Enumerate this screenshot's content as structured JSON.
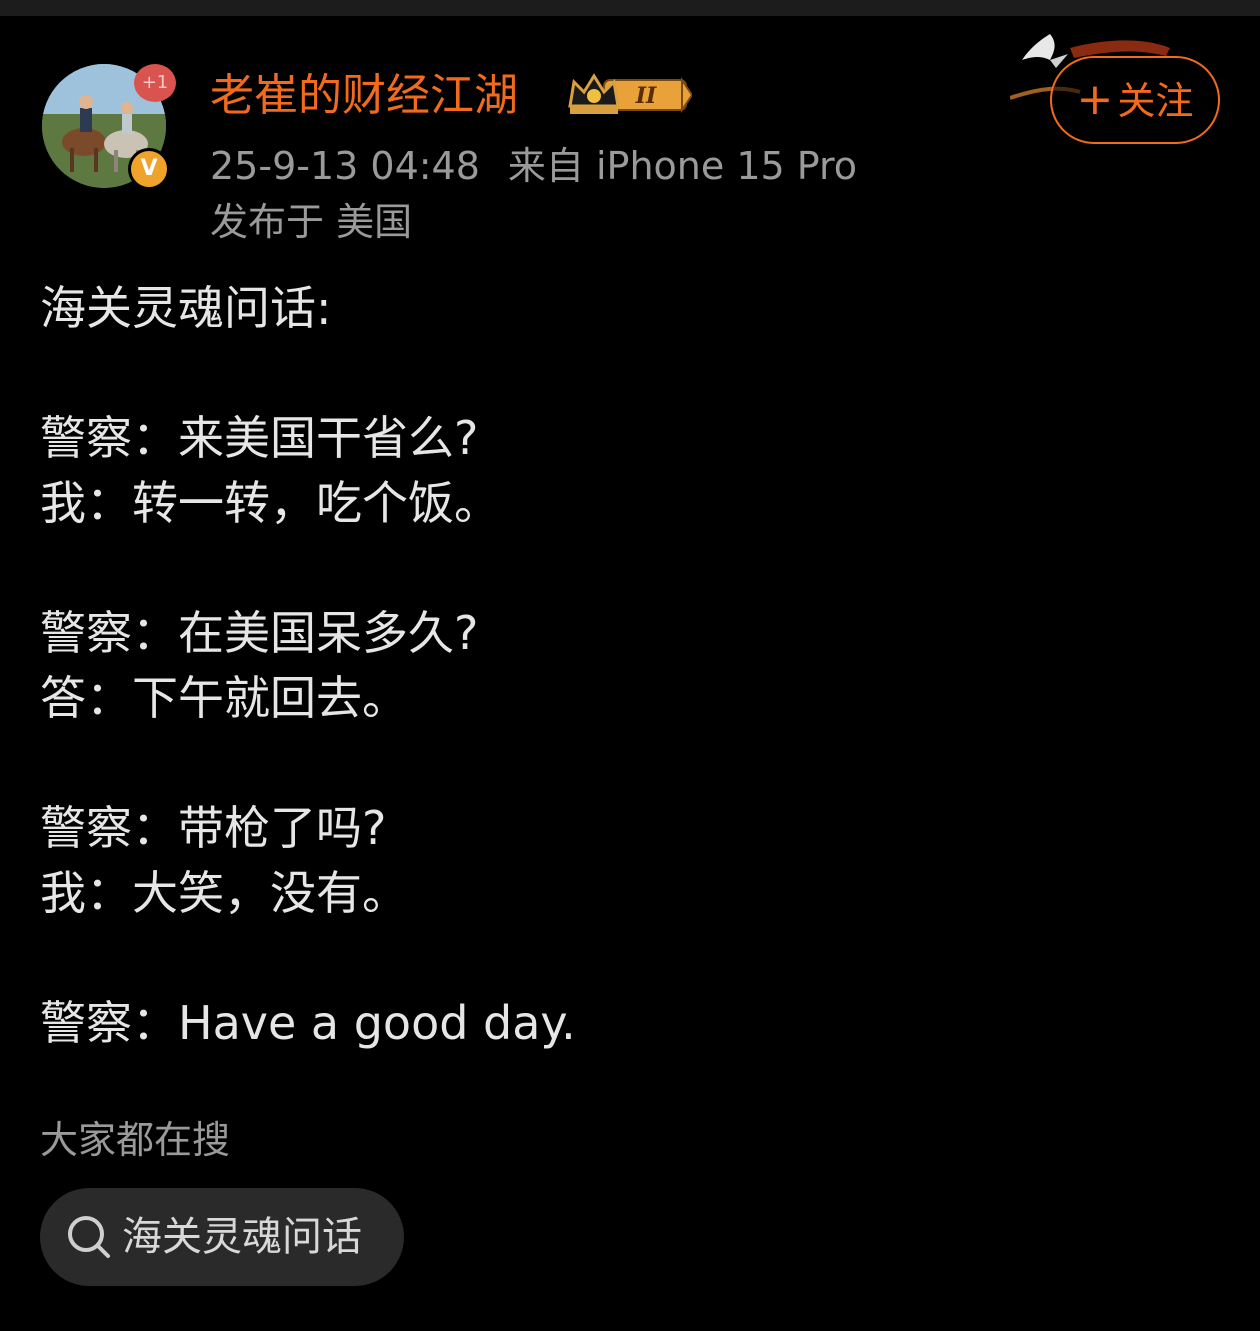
{
  "author": {
    "name": "老崔的财经江湖",
    "avatar_badge": "+1",
    "verified_badge": "V",
    "level_badge": "II"
  },
  "post_meta": {
    "time": "25-9-13 04:48",
    "source": "来自 iPhone 15 Pro",
    "location": "发布于 美国"
  },
  "follow_button": {
    "plus": "+",
    "label": "关注"
  },
  "content": [
    "海关灵魂问话:",
    "",
    "警察：来美国干省么?",
    "我：转一转，吃个饭。",
    "",
    "警察：在美国呆多久?",
    "答：下午就回去。",
    "",
    "警察：带枪了吗?",
    "我：大笑，没有。",
    "",
    "警察：Have a good day."
  ],
  "search": {
    "label": "大家都在搜",
    "chip": "海关灵魂问话"
  },
  "colors": {
    "accent": "#f26b1d",
    "background": "#000000",
    "muted": "#9a9a9a",
    "chip_bg": "#2a2a2a"
  },
  "icons": [
    "search-icon",
    "crown-icon",
    "verified-icon",
    "dove-icon"
  ]
}
